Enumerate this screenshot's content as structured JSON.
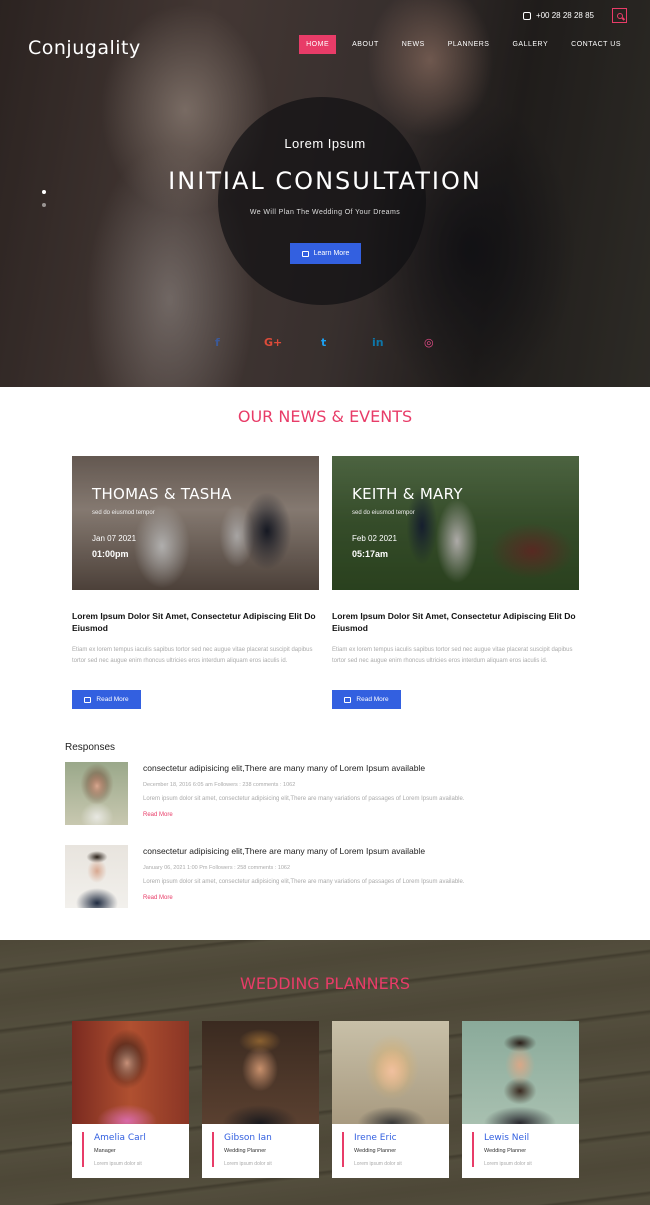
{
  "header": {
    "phone": "+00 28 28 28 85",
    "logo": "Conjugality",
    "nav": [
      "HOME",
      "ABOUT",
      "NEWS",
      "PLANNERS",
      "GALLERY",
      "CONTACT US"
    ]
  },
  "hero": {
    "subtitle": "Lorem Ipsum",
    "title": "INITIAL CONSULTATION",
    "tagline": "We Will Plan The Wedding Of Your Dreams",
    "button": "Learn More",
    "social": [
      "f",
      "G+",
      "t",
      "in",
      "◎"
    ]
  },
  "news": {
    "title": "OUR NEWS & EVENTS",
    "events": [
      {
        "name": "THOMAS & TASHA",
        "desc": "sed do eiusmod tempor",
        "date": "Jan 07 2021",
        "time": "01:00pm",
        "heading": "Lorem Ipsum Dolor Sit Amet, Consectetur Adipiscing Elit Do Eiusmod",
        "text": "Etiam ex lorem tempus iaculis sapibus tortor sed nec augue vitae placerat suscipit dapibus tortor sed nec augue enim rhoncus ultricies eros interdum aliquam eros iaculis id.",
        "button": "Read More"
      },
      {
        "name": "KEITH & MARY",
        "desc": "sed do eiusmod tempor",
        "date": "Feb 02 2021",
        "time": "05:17am",
        "heading": "Lorem Ipsum Dolor Sit Amet, Consectetur Adipiscing Elit Do Eiusmod",
        "text": "Etiam ex lorem tempus iaculis sapibus tortor sed nec augue vitae placerat suscipit dapibus tortor sed nec augue enim rhoncus ultricies eros interdum aliquam eros iaculis id.",
        "button": "Read More"
      }
    ]
  },
  "responses": {
    "title": "Responses",
    "items": [
      {
        "heading": "consectetur adipisicing elit,There are many many of Lorem Ipsum available",
        "meta": "December 18, 2016   6:05 am   Followers : 238   comments : 1062",
        "body": "Lorem ipsum dolor sit amet, consectetur adipisicing elit,There are many variations of passages of Lorem Ipsum available.",
        "link": "Read More"
      },
      {
        "heading": "consectetur adipisicing elit,There are many many of Lorem Ipsum available",
        "meta": "January 06, 2021   1:00 Pm   Followers : 258   comments : 1062",
        "body": "Lorem ipsum dolor sit amet, consectetur adipisicing elit,There are many variations of passages of Lorem Ipsum available.",
        "link": "Read More"
      }
    ]
  },
  "planners": {
    "title": "WEDDING PLANNERS",
    "people": [
      {
        "name": "Amelia Carl",
        "role": "Manager",
        "text": "Lorem ipsum dolor sit"
      },
      {
        "name": "Gibson Ian",
        "role": "Wedding Planner",
        "text": "Lorem ipsum dolor sit"
      },
      {
        "name": "Irene Eric",
        "role": "Wedding Planner",
        "text": "Lorem ipsum dolor sit"
      },
      {
        "name": "Lewis Neil",
        "role": "Wedding Planner",
        "text": "Lorem ipsum dolor sit"
      }
    ]
  },
  "colors": {
    "accent": "#e83c68",
    "button": "#3360e0"
  }
}
